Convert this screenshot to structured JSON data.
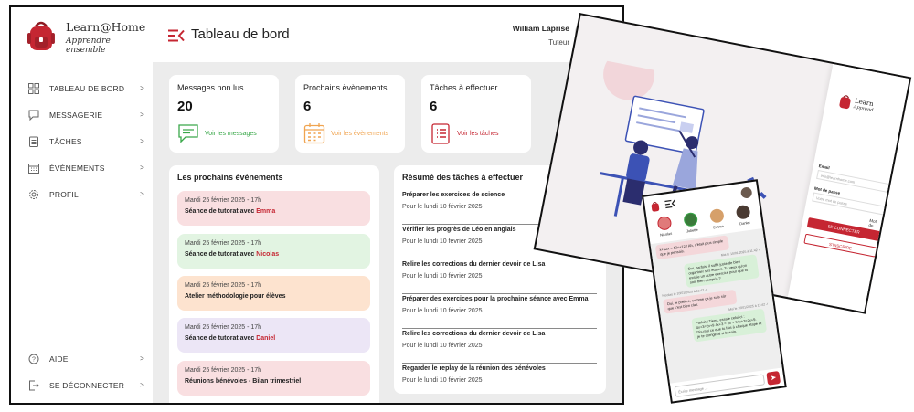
{
  "app": {
    "name": "Learn@Home",
    "tagline": "Apprendre ensemble"
  },
  "header": {
    "title": "Tableau de bord",
    "user_name": "William Laprise",
    "user_role": "Tuteur"
  },
  "sidebar": {
    "items": [
      {
        "label": "TABLEAU DE BORD",
        "icon": "dashboard-icon"
      },
      {
        "label": "MESSAGERIE",
        "icon": "message-icon"
      },
      {
        "label": "TÂCHES",
        "icon": "clipboard-icon"
      },
      {
        "label": "ÈVÈNEMENTS",
        "icon": "calendar-icon"
      },
      {
        "label": "PROFIL",
        "icon": "gear-icon"
      }
    ],
    "bottom": [
      {
        "label": "AIDE",
        "icon": "help-icon"
      },
      {
        "label": "SE DÉCONNECTER",
        "icon": "logout-icon"
      }
    ],
    "chevron": ">"
  },
  "stats": [
    {
      "title": "Messages non lus",
      "value": "20",
      "link": "Voir les messages",
      "color": "#3aa84a",
      "icon": "message-icon"
    },
    {
      "title": "Prochains èvènements",
      "value": "6",
      "link": "Voir les èvènements",
      "color": "#f0a450",
      "icon": "calendar-icon"
    },
    {
      "title": "Tâches à effectuer",
      "value": "6",
      "link": "Voir les tâches",
      "color": "#c52632",
      "icon": "clipboard-icon"
    }
  ],
  "events": {
    "title": "Les prochains èvènements",
    "items": [
      {
        "date": "Mardi 25 février 2025 - 17h",
        "title": "Séance de tutorat avec ",
        "who": "Emma",
        "color": "#f9dfe1"
      },
      {
        "date": "Mardi 25 février 2025 - 17h",
        "title": "Séance de tutorat avec ",
        "who": "Nicolas",
        "color": "#e2f4e2"
      },
      {
        "date": "Mardi 25 février 2025 - 17h",
        "title": "Atelier méthodologie pour élèves",
        "who": "",
        "color": "#fde3cf"
      },
      {
        "date": "Mardi 25 février 2025 - 17h",
        "title": "Séance de tutorat avec ",
        "who": "Daniel",
        "color": "#ece6f6"
      },
      {
        "date": "Mardi 25 février 2025 - 17h",
        "title": "Réunions bénévoles - Bilan trimestriel",
        "who": "",
        "color": "#f9dfe1"
      }
    ]
  },
  "tasks": {
    "title": "Résumé des tâches à effectuer",
    "items": [
      {
        "title": "Préparer les exercices de science",
        "due": "Pour le lundi 10 février 2025"
      },
      {
        "title": "Vérifier les progrès de Léo en anglais",
        "due": "Pour le lundi 10 février 2025"
      },
      {
        "title": "Relire les corrections du dernier devoir de Lisa",
        "due": "Pour le lundi 10 février 2025"
      },
      {
        "title": "Préparer des exercices pour la prochaine séance avec Emma",
        "due": "Pour le lundi 10 février 2025"
      },
      {
        "title": "Relire les corrections du dernier devoir de Lisa",
        "due": "Pour le lundi 10 février 2025"
      },
      {
        "title": "Regarder le replay de la réunion des bénévoles",
        "due": "Pour le lundi 10 février 2025"
      }
    ]
  },
  "login": {
    "brand": "Learn",
    "tagline": "Apprend",
    "email_label": "Email",
    "email_placeholder": "info@learnhome.com",
    "password_label": "Mot de passe",
    "password_placeholder": "Votre mot de passe",
    "forgot": "Mot de",
    "connect": "SE CONNECTER",
    "register": "S'INSCRIRE"
  },
  "mobile": {
    "contacts": [
      "Nicolas",
      "Juliette",
      "Emma",
      "Daniel"
    ],
    "messages": [
      {
        "dir": "in",
        "text": "x+12x = 12x+12 ! Ah, c'était plus simple que je pensais."
      },
      {
        "dir": "meta-r",
        "text": "Moi le 10/01/2025 à 11:42 ✓"
      },
      {
        "dir": "out",
        "text": "Oui, parfois, il suffit juste de bien organiser ses étapes. Tu veux qu'on essaie un autre exercice pour que tu sois bien compris ?"
      },
      {
        "dir": "meta",
        "text": "Nicolas le 10/01/2025 à 11:42 ✓"
      },
      {
        "dir": "in",
        "text": "Oui, je préfère, comme ça je suis sûr que c'est bien clair."
      },
      {
        "dir": "meta-r",
        "text": "Moi le 10/01/2025 à 11:42 ✓"
      },
      {
        "dir": "out",
        "text": "Parfait ! Tiens, essaie celui-ci : 4x+3=2x+9 4x+3 = 2x + 94x+3=2x+9. Dis-moi ce que tu fais à chaque étape et je te corrigerai si besoin."
      }
    ],
    "placeholder": "Écrire message ...",
    "send_icon": "send-icon"
  },
  "colors": {
    "accent": "#c52632",
    "content_bg": "#ececec"
  }
}
